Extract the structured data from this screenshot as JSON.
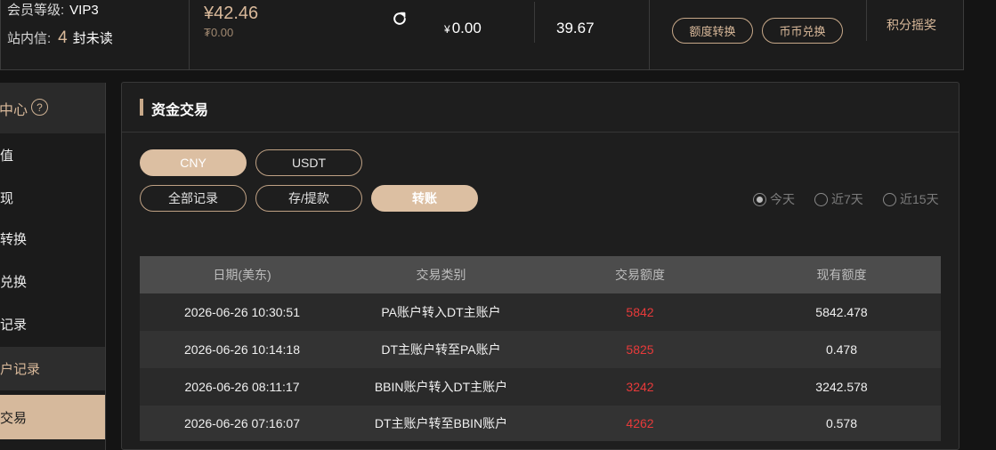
{
  "header": {
    "member_level_label": "会员等级:",
    "member_level_value": "VIP3",
    "inbox_label": "站内信:",
    "inbox_count": "4",
    "inbox_unit": "封未读",
    "balance_main": "¥42.46",
    "balance_sub": "₮0.00",
    "amount_1_currency": "¥",
    "amount_1": "0.00",
    "amount_2": "39.67",
    "quota_transfer_label": "额度转换",
    "coin_exchange_label": "币币兑换",
    "lottery_label": "积分摇奖"
  },
  "sidebar": {
    "header_label": "中心",
    "help_glyph": "?",
    "items": [
      {
        "label": "值"
      },
      {
        "label": "现"
      },
      {
        "label": "转换"
      },
      {
        "label": "兑换"
      },
      {
        "label": "记录"
      },
      {
        "label": "户记录"
      },
      {
        "label": "交易"
      }
    ]
  },
  "panel": {
    "title": "资金交易",
    "currency_tabs": [
      {
        "label": "CNY",
        "active": true
      },
      {
        "label": "USDT",
        "active": false
      }
    ],
    "record_tabs": [
      {
        "label": "全部记录",
        "active": false
      },
      {
        "label": "存/提款",
        "active": false
      },
      {
        "label": "转账",
        "active": true
      }
    ],
    "date_filters": [
      {
        "label": "今天",
        "checked": true
      },
      {
        "label": "近7天",
        "checked": false
      },
      {
        "label": "近15天",
        "checked": false
      }
    ]
  },
  "table": {
    "columns": [
      "日期(美东)",
      "交易类别",
      "交易额度",
      "现有额度"
    ],
    "rows": [
      {
        "date": "2026-06-26 10:30:51",
        "type": "PA账户转入DT主账户",
        "amount": "5842",
        "balance": "5842.478"
      },
      {
        "date": "2026-06-26 10:14:18",
        "type": "DT主账户转至PA账户",
        "amount": "5825",
        "balance": "0.478"
      },
      {
        "date": "2026-06-26 08:11:17",
        "type": "BBIN账户转入DT主账户",
        "amount": "3242",
        "balance": "3242.578"
      },
      {
        "date": "2026-06-26 07:16:07",
        "type": "DT主账户转至BBIN账户",
        "amount": "4262",
        "balance": "0.578"
      }
    ]
  },
  "colors": {
    "accent": "#d9b99a",
    "negative": "#e83a3a"
  }
}
